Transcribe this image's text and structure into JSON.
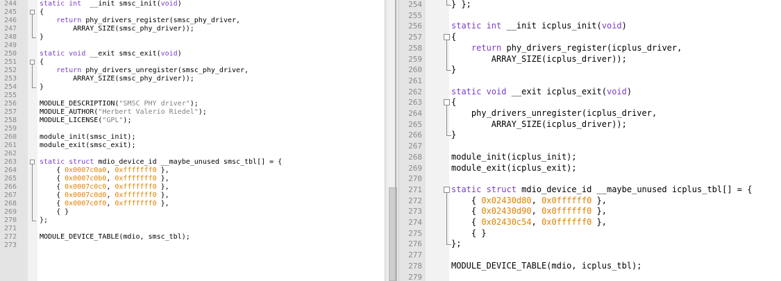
{
  "left": {
    "lines": [
      {
        "n": "244",
        "t": [
          [
            "kw",
            "static int"
          ],
          [
            "",
            "  __init smsc_init("
          ],
          [
            "kw",
            "void"
          ],
          [
            "",
            ")"
          ]
        ]
      },
      {
        "n": "245",
        "t": [
          [
            "",
            "{"
          ]
        ]
      },
      {
        "n": "246",
        "t": [
          [
            "",
            "    "
          ],
          [
            "kw",
            "return"
          ],
          [
            "",
            " phy_drivers_register(smsc_phy_driver,"
          ]
        ]
      },
      {
        "n": "247",
        "t": [
          [
            "",
            "        ARRAY_SIZE(smsc_phy_driver));"
          ]
        ]
      },
      {
        "n": "248",
        "t": [
          [
            "",
            "}"
          ]
        ]
      },
      {
        "n": "249",
        "t": []
      },
      {
        "n": "250",
        "t": [
          [
            "kw",
            "static void"
          ],
          [
            "",
            " __exit smsc_exit("
          ],
          [
            "kw",
            "void"
          ],
          [
            "",
            ")"
          ]
        ]
      },
      {
        "n": "251",
        "t": [
          [
            "",
            "{"
          ]
        ]
      },
      {
        "n": "252",
        "t": [
          [
            "",
            "    "
          ],
          [
            "kw",
            "return"
          ],
          [
            "",
            " phy_drivers_unregister(smsc_phy_driver,"
          ]
        ]
      },
      {
        "n": "253",
        "t": [
          [
            "",
            "        ARRAY_SIZE(smsc_phy_driver));"
          ]
        ]
      },
      {
        "n": "254",
        "t": [
          [
            "",
            "}"
          ]
        ]
      },
      {
        "n": "255",
        "t": []
      },
      {
        "n": "256",
        "t": [
          [
            "",
            "MODULE_DESCRIPTION("
          ],
          [
            "str",
            "\"SMSC PHY driver\""
          ],
          [
            "",
            ");"
          ]
        ]
      },
      {
        "n": "257",
        "t": [
          [
            "",
            "MODULE_AUTHOR("
          ],
          [
            "str",
            "\"Herbert Valerio Riedel\""
          ],
          [
            "",
            ");"
          ]
        ]
      },
      {
        "n": "258",
        "t": [
          [
            "",
            "MODULE_LICENSE("
          ],
          [
            "str",
            "\"GPL\""
          ],
          [
            "",
            ");"
          ]
        ]
      },
      {
        "n": "259",
        "t": []
      },
      {
        "n": "260",
        "t": [
          [
            "",
            "module_init(smsc_init);"
          ]
        ]
      },
      {
        "n": "261",
        "t": [
          [
            "",
            "module_exit(smsc_exit);"
          ]
        ]
      },
      {
        "n": "262",
        "t": []
      },
      {
        "n": "263",
        "t": [
          [
            "kw",
            "static struct"
          ],
          [
            "",
            " mdio_device_id __maybe_unused smsc_tbl[] = {"
          ]
        ]
      },
      {
        "n": "264",
        "t": [
          [
            "",
            "    { "
          ],
          [
            "num",
            "0x0007c0a0"
          ],
          [
            "",
            ", "
          ],
          [
            "num",
            "0xfffffff0"
          ],
          [
            "",
            " },"
          ]
        ]
      },
      {
        "n": "265",
        "t": [
          [
            "",
            "    { "
          ],
          [
            "num",
            "0x0007c0b0"
          ],
          [
            "",
            ", "
          ],
          [
            "num",
            "0xfffffff0"
          ],
          [
            "",
            " },"
          ]
        ]
      },
      {
        "n": "266",
        "t": [
          [
            "",
            "    { "
          ],
          [
            "num",
            "0x0007c0c0"
          ],
          [
            "",
            ", "
          ],
          [
            "num",
            "0xfffffff0"
          ],
          [
            "",
            " },"
          ]
        ]
      },
      {
        "n": "267",
        "t": [
          [
            "",
            "    { "
          ],
          [
            "num",
            "0x0007c0d0"
          ],
          [
            "",
            ", "
          ],
          [
            "num",
            "0xfffffff0"
          ],
          [
            "",
            " },"
          ]
        ]
      },
      {
        "n": "268",
        "t": [
          [
            "",
            "    { "
          ],
          [
            "num",
            "0x0007c0f0"
          ],
          [
            "",
            ", "
          ],
          [
            "num",
            "0xfffffff0"
          ],
          [
            "",
            " },"
          ]
        ]
      },
      {
        "n": "269",
        "t": [
          [
            "",
            "    { }"
          ]
        ]
      },
      {
        "n": "270",
        "t": [
          [
            "",
            "};"
          ]
        ]
      },
      {
        "n": "271",
        "t": []
      },
      {
        "n": "272",
        "t": [
          [
            "",
            "MODULE_DEVICE_TABLE(mdio, smsc_tbl);"
          ]
        ]
      },
      {
        "n": "273",
        "t": []
      }
    ]
  },
  "right": {
    "lines": [
      {
        "n": "254",
        "t": [
          [
            "",
            "} };"
          ]
        ]
      },
      {
        "n": "255",
        "t": []
      },
      {
        "n": "256",
        "t": [
          [
            "kw",
            "static int"
          ],
          [
            "",
            " __init icplus_init("
          ],
          [
            "kw",
            "void"
          ],
          [
            "",
            ")"
          ]
        ]
      },
      {
        "n": "257",
        "t": [
          [
            "",
            "{"
          ]
        ]
      },
      {
        "n": "258",
        "t": [
          [
            "",
            "    "
          ],
          [
            "kw",
            "return"
          ],
          [
            "",
            " phy_drivers_register(icplus_driver,"
          ]
        ]
      },
      {
        "n": "259",
        "t": [
          [
            "",
            "        ARRAY_SIZE(icplus_driver));"
          ]
        ]
      },
      {
        "n": "260",
        "t": [
          [
            "",
            "}"
          ]
        ]
      },
      {
        "n": "261",
        "t": []
      },
      {
        "n": "262",
        "t": [
          [
            "kw",
            "static void"
          ],
          [
            "",
            " __exit icplus_exit("
          ],
          [
            "kw",
            "void"
          ],
          [
            "",
            ")"
          ]
        ]
      },
      {
        "n": "263",
        "t": [
          [
            "",
            "{"
          ]
        ]
      },
      {
        "n": "264",
        "t": [
          [
            "",
            "    phy_drivers_unregister(icplus_driver,"
          ]
        ]
      },
      {
        "n": "265",
        "t": [
          [
            "",
            "        ARRAY_SIZE(icplus_driver));"
          ]
        ]
      },
      {
        "n": "266",
        "t": [
          [
            "",
            "}"
          ]
        ]
      },
      {
        "n": "267",
        "t": []
      },
      {
        "n": "268",
        "t": [
          [
            "",
            "module_init(icplus_init);"
          ]
        ]
      },
      {
        "n": "269",
        "t": [
          [
            "",
            "module_exit(icplus_exit);"
          ]
        ]
      },
      {
        "n": "270",
        "t": []
      },
      {
        "n": "271",
        "t": [
          [
            "kw",
            "static struct"
          ],
          [
            "",
            " mdio_device_id __maybe_unused icplus_tbl[] = {"
          ]
        ]
      },
      {
        "n": "272",
        "t": [
          [
            "",
            "    { "
          ],
          [
            "num",
            "0x02430d80"
          ],
          [
            "",
            ", "
          ],
          [
            "num",
            "0x0ffffff0"
          ],
          [
            "",
            " },"
          ]
        ]
      },
      {
        "n": "273",
        "t": [
          [
            "",
            "    { "
          ],
          [
            "num",
            "0x02430d90"
          ],
          [
            "",
            ", "
          ],
          [
            "num",
            "0x0ffffff0"
          ],
          [
            "",
            " },"
          ]
        ]
      },
      {
        "n": "274",
        "t": [
          [
            "",
            "    { "
          ],
          [
            "num",
            "0x02430c54"
          ],
          [
            "",
            ", "
          ],
          [
            "num",
            "0x0ffffff0"
          ],
          [
            "",
            " },"
          ]
        ]
      },
      {
        "n": "275",
        "t": [
          [
            "",
            "    { }"
          ]
        ]
      },
      {
        "n": "276",
        "t": [
          [
            "",
            "};"
          ]
        ]
      },
      {
        "n": "277",
        "t": []
      },
      {
        "n": "278",
        "t": [
          [
            "",
            "MODULE_DEVICE_TABLE(mdio, icplus_tbl);"
          ]
        ]
      },
      {
        "n": "279",
        "t": []
      }
    ]
  },
  "colors": {
    "keyword": "#7a3ec8",
    "string": "#808080",
    "number": "#e08000",
    "gutter": "#e4e4e4"
  }
}
